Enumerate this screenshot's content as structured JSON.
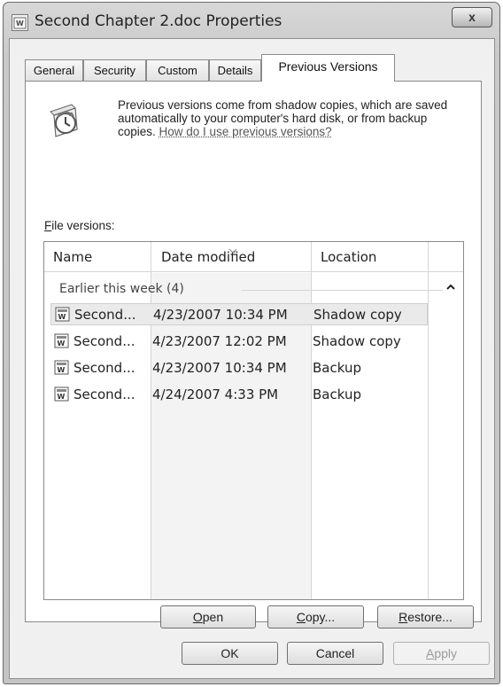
{
  "window": {
    "title": "Second Chapter 2.doc Properties",
    "close_label": "x"
  },
  "tabs": [
    {
      "label": "General"
    },
    {
      "label": "Security"
    },
    {
      "label": "Custom"
    },
    {
      "label": "Details"
    },
    {
      "label": "Previous Versions",
      "active": true
    }
  ],
  "info": {
    "text": "Previous versions come from shadow copies, which are saved automatically to your computer's hard disk, or from backup copies. ",
    "link": "How do I use previous versions?"
  },
  "file_versions": {
    "label_prefix": "F",
    "label_rest": "ile versions:",
    "columns": [
      "Name",
      "Date modified",
      "Location"
    ],
    "group": "Earlier this week (4)",
    "rows": [
      {
        "name": "Second...",
        "date": "4/23/2007 10:34 PM",
        "location": "Shadow copy",
        "selected": true
      },
      {
        "name": "Second...",
        "date": "4/23/2007 12:02 PM",
        "location": "Shadow copy"
      },
      {
        "name": "Second...",
        "date": "4/23/2007 10:34 PM",
        "location": "Backup"
      },
      {
        "name": "Second...",
        "date": "4/24/2007 4:33 PM",
        "location": "Backup"
      }
    ]
  },
  "actions": {
    "open_prefix": "O",
    "open_rest": "pen",
    "copy_prefix": "C",
    "copy_rest": "opy...",
    "restore_prefix": "R",
    "restore_rest": "estore..."
  },
  "dialog_buttons": {
    "ok": "OK",
    "cancel": "Cancel",
    "apply_prefix": "A",
    "apply_rest": "pply"
  },
  "icons": {
    "window": "word-document-icon",
    "info": "previous-versions-clock-icon",
    "row": "word-document-icon",
    "sort": "sort-descending-icon",
    "group_toggle": "chevron-up-icon"
  }
}
